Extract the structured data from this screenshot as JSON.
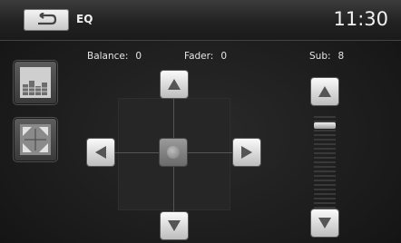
{
  "header": {
    "title": "EQ",
    "time": "11:30"
  },
  "readouts": {
    "balance_label": "Balance:",
    "balance_value": "0",
    "fader_label": "Fader:",
    "fader_value": "0",
    "sub_label": "Sub:",
    "sub_value": "8"
  },
  "icons": {
    "back": "return-arrow-icon",
    "eq_mode": "equalizer-bars-icon",
    "balance_mode": "balance-fader-icon",
    "up": "triangle-up-icon",
    "down": "triangle-down-icon",
    "left": "triangle-left-icon",
    "right": "triangle-right-icon"
  },
  "sub_slider": {
    "level_fraction": 0.92
  },
  "colors": {
    "arrow": "#555555",
    "background": "#1b1b1b"
  }
}
